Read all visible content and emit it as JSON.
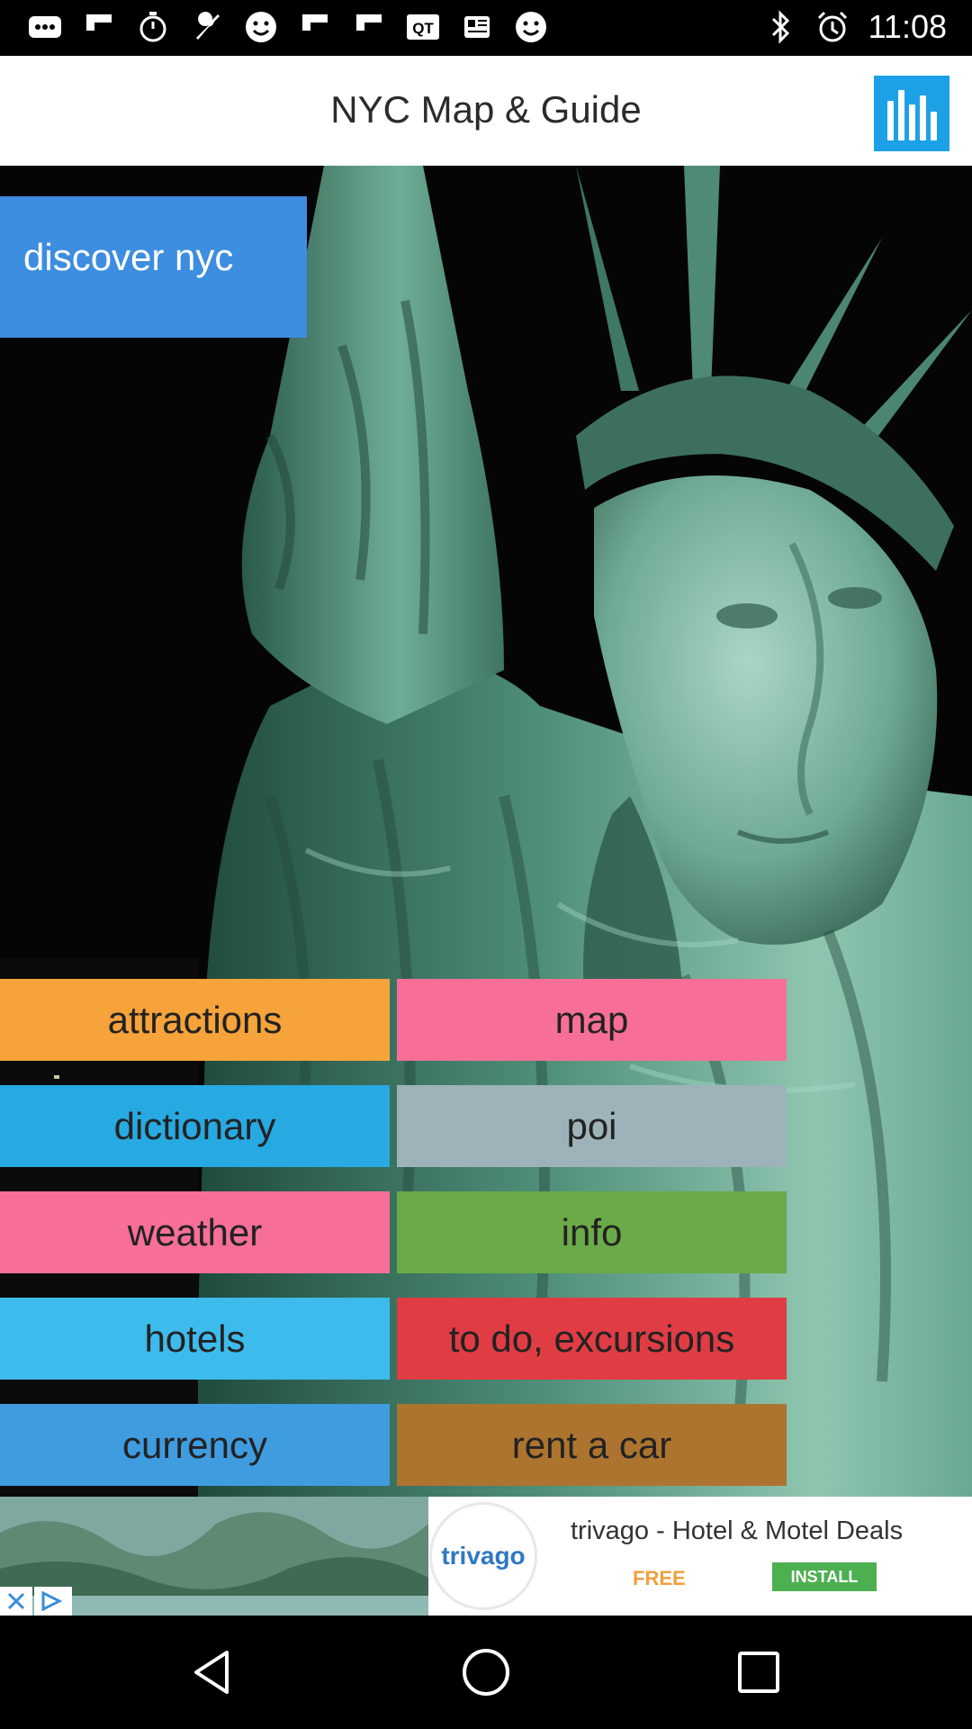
{
  "status_bar": {
    "time": "11:08",
    "notification_icons": [
      "more-icon",
      "flipboard-icon",
      "timer-icon",
      "wrench-icon",
      "smiley-icon",
      "flipboard-icon",
      "flipboard-icon",
      "qt-icon",
      "news-icon",
      "smiley-icon"
    ],
    "system_icons": [
      "bluetooth-icon",
      "alarm-icon"
    ]
  },
  "app_bar": {
    "title": "NYC Map & Guide",
    "stats_icon": "bar-chart-icon",
    "accent": "#1da1e6"
  },
  "hero": {
    "banner_label": "discover nyc",
    "banner_color": "#3d8de0"
  },
  "menu": {
    "attractions": "attractions",
    "map": "map",
    "dictionary": "dictionary",
    "poi": "poi",
    "weather": "weather",
    "info": "info",
    "hotels": "hotels",
    "todo": "to do, excursions",
    "currency": "currency",
    "rent": "rent a car"
  },
  "menu_colors": {
    "attractions": "#f5a33a",
    "map": "#f76f97",
    "dictionary": "#27a9e1",
    "poi": "#9eb3b9",
    "weather": "#f76f97",
    "info": "#6aaa48",
    "hotels": "#3dbbec",
    "todo": "#e03c44",
    "currency": "#3f9cdf",
    "rent": "#ad742f"
  },
  "ad": {
    "logo_text": "trivago",
    "title": "trivago - Hotel & Motel Deals",
    "price": "FREE",
    "install_label": "INSTALL"
  },
  "nav_bar": {
    "back_icon": "back-icon",
    "home_icon": "home-icon",
    "recents_icon": "recents-icon"
  }
}
